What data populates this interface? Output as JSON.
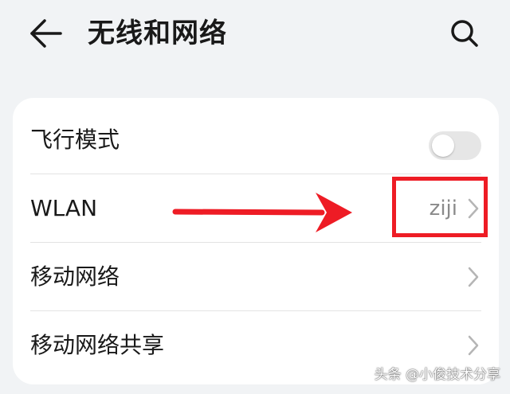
{
  "header": {
    "title": "无线和网络"
  },
  "settings": {
    "rows": [
      {
        "label": "飞行模式",
        "control": "toggle",
        "on": false
      },
      {
        "label": "WLAN",
        "value": "ziji"
      },
      {
        "label": "移动网络"
      },
      {
        "label": "移动网络共享"
      }
    ]
  },
  "colors": {
    "background": "#f1f3f5",
    "card": "#ffffff",
    "annotation": "#ee1c25"
  },
  "icons": {
    "back": "arrow-left-icon",
    "search": "search-icon",
    "chevron": "chevron-right-icon"
  },
  "watermark": "头条 @小俊技术分享"
}
